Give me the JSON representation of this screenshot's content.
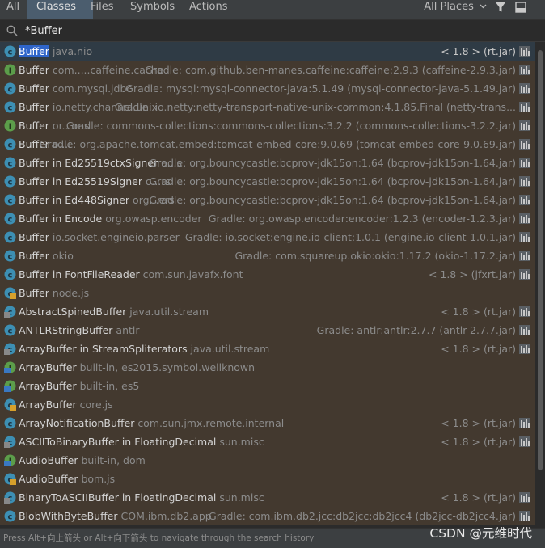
{
  "tabs": [
    {
      "label": "All",
      "active": false
    },
    {
      "label": "Classes",
      "active": true
    },
    {
      "label": "Files",
      "active": false
    },
    {
      "label": "Symbols",
      "active": false
    },
    {
      "label": "Actions",
      "active": false
    }
  ],
  "places_label": "All Places",
  "search": {
    "value": "*Buffer"
  },
  "results": [
    {
      "icon": "class-icon",
      "hl": "Buffer",
      "rest": " ",
      "ctx": "java.nio",
      "loc": "< 1.8 > (rt.jar)",
      "style": "selected"
    },
    {
      "icon": "interface-icon",
      "hl": "",
      "rest": "Buffer ",
      "ctx": "com.....caffeine.cache",
      "loc": "Gradle: com.github.ben-manes.caffeine:caffeine:2.9.3 (caffeine-2.9.3.jar)",
      "style": "tinted"
    },
    {
      "icon": "class-icon",
      "hl": "",
      "rest": "Buffer ",
      "ctx": "com.mysql.jdbc",
      "loc": "Gradle: mysql:mysql-connector-java:5.1.49 (mysql-connector-java-5.1.49.jar)",
      "style": "tinted"
    },
    {
      "icon": "class-icon",
      "hl": "",
      "rest": "Buffer ",
      "ctx": "io.netty.channel.unix",
      "loc": "Gradle: io.netty:netty-transport-native-unix-common:4.1.85.Final (netty-trans...",
      "style": "tinted"
    },
    {
      "icon": "interface-icon",
      "hl": "",
      "rest": "Buffer ",
      "ctx": "or...ons",
      "loc": "Gradle: commons-collections:commons-collections:3.2.2 (commons-collections-3.2.2.jar)",
      "style": "tinted"
    },
    {
      "icon": "class-icon",
      "hl": "",
      "rest": "Buffer ",
      "ctx": "o...i",
      "loc": "Gradle: org.apache.tomcat.embed:tomcat-embed-core:9.0.69 (tomcat-embed-core-9.0.69.jar)",
      "style": "tinted"
    },
    {
      "icon": "class-icon",
      "hl": "",
      "rest": "Buffer in Ed25519ctxSigner ",
      "ctx": "o...s",
      "loc": "Gradle: org.bouncycastle:bcprov-jdk15on:1.64 (bcprov-jdk15on-1.64.jar)",
      "style": "tinted"
    },
    {
      "icon": "class-icon",
      "hl": "",
      "rest": "Buffer in Ed25519Signer ",
      "ctx": "o...rs",
      "loc": "Gradle: org.bouncycastle:bcprov-jdk15on:1.64 (bcprov-jdk15on-1.64.jar)",
      "style": "tinted"
    },
    {
      "icon": "class-icon",
      "hl": "",
      "rest": "Buffer in Ed448Signer ",
      "ctx": "org...ers",
      "loc": "Gradle: org.bouncycastle:bcprov-jdk15on:1.64 (bcprov-jdk15on-1.64.jar)",
      "style": "tinted"
    },
    {
      "icon": "class-icon",
      "hl": "",
      "rest": "Buffer in Encode ",
      "ctx": "org.owasp.encoder",
      "loc": "Gradle: org.owasp.encoder:encoder:1.2.3 (encoder-1.2.3.jar)",
      "style": "tinted"
    },
    {
      "icon": "class-icon",
      "hl": "",
      "rest": "Buffer ",
      "ctx": "io.socket.engineio.parser",
      "loc": "Gradle: io.socket:engine.io-client:1.0.1 (engine.io-client-1.0.1.jar)",
      "style": "tinted"
    },
    {
      "icon": "class-icon",
      "hl": "",
      "rest": "Buffer ",
      "ctx": "okio",
      "loc": "Gradle: com.squareup.okio:okio:1.17.2 (okio-1.17.2.jar)",
      "style": "tinted"
    },
    {
      "icon": "class-icon",
      "hl": "",
      "rest": "Buffer in FontFileReader ",
      "ctx": "com.sun.javafx.font",
      "loc": "< 1.8 > (jfxrt.jar)",
      "style": "tinted"
    },
    {
      "icon": "js-class-icon",
      "hl": "",
      "rest": "Buffer ",
      "ctx": "node.js",
      "loc": "",
      "style": "tinted"
    },
    {
      "icon": "abstract-class-icon",
      "hl": "",
      "rest": "AbstractSpinedBuffer ",
      "ctx": "java.util.stream",
      "loc": "< 1.8 > (rt.jar)",
      "style": "tinted"
    },
    {
      "icon": "class-icon",
      "hl": "",
      "rest": "ANTLRStringBuffer ",
      "ctx": "antlr",
      "loc": "Gradle: antlr:antlr:2.7.7 (antlr-2.7.7.jar)",
      "style": "tinted"
    },
    {
      "icon": "abstract-class-icon",
      "hl": "",
      "rest": "ArrayBuffer in StreamSpliterators ",
      "ctx": "java.util.stream",
      "loc": "< 1.8 > (rt.jar)",
      "style": "tinted"
    },
    {
      "icon": "ts-interface-icon",
      "hl": "",
      "rest": "ArrayBuffer ",
      "ctx": "built-in, es2015.symbol.wellknown",
      "loc": "",
      "style": "tinted"
    },
    {
      "icon": "ts-interface-icon",
      "hl": "",
      "rest": "ArrayBuffer ",
      "ctx": "built-in, es5",
      "loc": "",
      "style": "tinted"
    },
    {
      "icon": "js-class-icon",
      "hl": "",
      "rest": "ArrayBuffer ",
      "ctx": "core.js",
      "loc": "",
      "style": "tinted"
    },
    {
      "icon": "class-icon",
      "hl": "",
      "rest": "ArrayNotificationBuffer ",
      "ctx": "com.sun.jmx.remote.internal",
      "loc": "< 1.8 > (rt.jar)",
      "style": "tinted"
    },
    {
      "icon": "abstract-class-icon",
      "hl": "",
      "rest": "ASCIIToBinaryBuffer in FloatingDecimal ",
      "ctx": "sun.misc",
      "loc": "< 1.8 > (rt.jar)",
      "style": "tinted"
    },
    {
      "icon": "ts-interface-icon",
      "hl": "",
      "rest": "AudioBuffer ",
      "ctx": "built-in, dom",
      "loc": "",
      "style": "tinted"
    },
    {
      "icon": "js-class-icon",
      "hl": "",
      "rest": "AudioBuffer ",
      "ctx": "bom.js",
      "loc": "",
      "style": "tinted"
    },
    {
      "icon": "abstract-class-icon",
      "hl": "",
      "rest": "BinaryToASCIIBuffer in FloatingDecimal ",
      "ctx": "sun.misc",
      "loc": "< 1.8 > (rt.jar)",
      "style": "tinted"
    },
    {
      "icon": "class-icon",
      "hl": "",
      "rest": "BlobWithByteBuffer ",
      "ctx": "COM.ibm.db2.app",
      "loc": "Gradle: com.ibm.db2.jcc:db2jcc:db2jcc4 (db2jcc-db2jcc4.jar)",
      "style": "tinted"
    }
  ],
  "footer": {
    "hint": "Press Alt+向上箭头 or Alt+向下箭头 to navigate through the search history",
    "watermark": "CSDN @元维时代"
  },
  "colors": {
    "selection": "#2f65ca",
    "tinted_row": "#43392f",
    "class_icon": "#3d8fb3",
    "interface_icon": "#5c9d4a",
    "js_badge": "#d6a02b"
  }
}
